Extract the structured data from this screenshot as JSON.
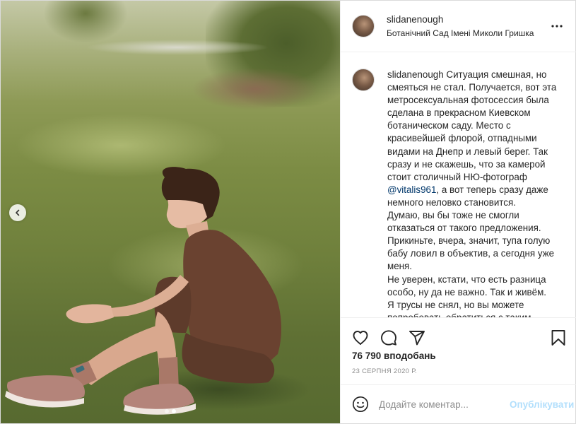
{
  "post": {
    "username": "slidanenough",
    "location": "Ботанічний Сад Імені Миколи Гришка",
    "caption": {
      "username": "slidanenough",
      "text_before_mention": " Ситуация смешная, но смеяться не стал. Получается, вот эта метросексуальная фотосессия была сделана в прекрасном Киевском ботаническом саду. Место с красивейшей флорой, отпадными видами на Днепр и левый берег. Так сразу и не скажешь, что за камерой стоит столичный НЮ-фотограф ",
      "mention": "@vitalis961",
      "text_after_mention": ", а вот теперь сразу даже немного неловко становится.",
      "paragraph_2": "Думаю, вы бы тоже не смогли отказаться от такого предложения. Прикиньте, вчера, значит, тупа голую бабу ловил в объектив, а сегодня уже меня.",
      "paragraph_3": "Не уверен, кстати, что есть разница особо, ну да не важно. Так и живём.",
      "paragraph_4": "Я трусы не снял, но вы можете попробовать обратиться с таким"
    },
    "likes": "76 790 вподобань",
    "date": "23 серпня 2020 р.",
    "comment": {
      "placeholder": "Додайте коментар...",
      "value": "",
      "publish_label": "Опублікувати"
    },
    "carousel": {
      "total": 2,
      "current": 2
    },
    "icons": {
      "more": "more-options-icon",
      "like": "heart-icon",
      "comment": "comment-icon",
      "share": "paper-plane-icon",
      "save": "bookmark-icon",
      "emoji": "smiley-icon",
      "prev": "chevron-left-icon"
    },
    "colors": {
      "text": "#262626",
      "secondary": "#8e8e8e",
      "mention": "#00376b",
      "publish_disabled": "#b2dffc",
      "border": "#dbdbdb"
    }
  }
}
